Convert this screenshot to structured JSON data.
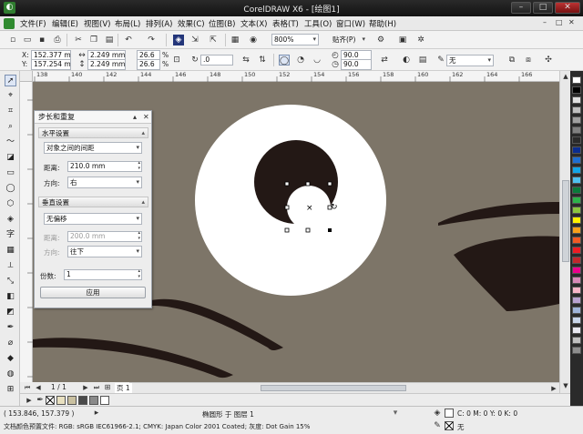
{
  "window": {
    "title": "CorelDRAW X6 - [绘图1]",
    "controls": [
      "–",
      "□",
      "✕"
    ]
  },
  "menubar": {
    "items": [
      "文件(F)",
      "编辑(E)",
      "视图(V)",
      "布局(L)",
      "排列(A)",
      "效果(C)",
      "位图(B)",
      "文本(X)",
      "表格(T)",
      "工具(O)",
      "窗口(W)",
      "帮助(H)"
    ],
    "mdi_controls": [
      "–",
      "□",
      "✕"
    ]
  },
  "standard_toolbar": {
    "zoom_value": "800%",
    "snap_label": "贴齐(P)"
  },
  "property_bar": {
    "x": "152.377 mm",
    "y": "157.254 mm",
    "width": "2.249 mm",
    "height": "2.249 mm",
    "scale_x": "26.6",
    "scale_y": "26.6",
    "percent": "%",
    "rotation": ".0",
    "angle1": "90.0",
    "angle2": "90.0",
    "outline_label": "无"
  },
  "ruler": {
    "top_ticks": [
      "138",
      "140",
      "142",
      "144",
      "146",
      "148",
      "150",
      "152",
      "154",
      "156",
      "158",
      "160",
      "162",
      "164",
      "166"
    ]
  },
  "docker": {
    "title": "步长和重复",
    "horizontal": {
      "header": "水平设置",
      "mode": "对象之间的间距",
      "distance_label": "距离:",
      "distance_value": "210.0 mm",
      "direction_label": "方向:",
      "direction_value": "右"
    },
    "vertical": {
      "header": "垂直设置",
      "mode": "无偏移",
      "distance_label": "距离:",
      "distance_value": "200.0 mm",
      "direction_label": "方向:",
      "direction_value": "往下"
    },
    "copies_label": "份数:",
    "copies_value": "1",
    "apply_label": "应用"
  },
  "pagebar": {
    "page_counter": "1 / 1",
    "page_tab": "页 1"
  },
  "status": {
    "coords": "( 153.846, 157.379 )",
    "selection": "椭圆形 于 图层 1",
    "fill": "C: 0 M: 0 Y: 0 K: 0",
    "outline": "无",
    "color_profile": "文档颜色预置文件: RGB: sRGB IEC61966-2.1; CMYK: Japan Color 2001 Coated; 灰度: Dot Gain 15%"
  },
  "palette_colors": [
    "#ffffff",
    "#000000",
    "#e0e0e0",
    "#c0c0c0",
    "#a0a0a0",
    "#808080",
    "#2a2a2a",
    "#0b2d8f",
    "#1f6fd1",
    "#13a6e8",
    "#4fc1f0",
    "#0a7a3a",
    "#2db34a",
    "#8cc63f",
    "#fff200",
    "#f7a11a",
    "#f15a24",
    "#ed1c24",
    "#c1272d",
    "#ec008c",
    "#d88ab8",
    "#f7b6c9",
    "#b8a2d0",
    "#9fb4d9",
    "#c9d6ea",
    "#e8e8f0",
    "#bfbfbf",
    "#8e8e8e"
  ],
  "doc_palette_colors": [
    "#e8e0c0",
    "#c9c0a0",
    "#4a4a4a",
    "#8a8a8a",
    "#ffffff"
  ],
  "colors": {
    "canvas": "#7d7568",
    "dark_shape": "#231815",
    "white_shape": "#ffffff"
  }
}
